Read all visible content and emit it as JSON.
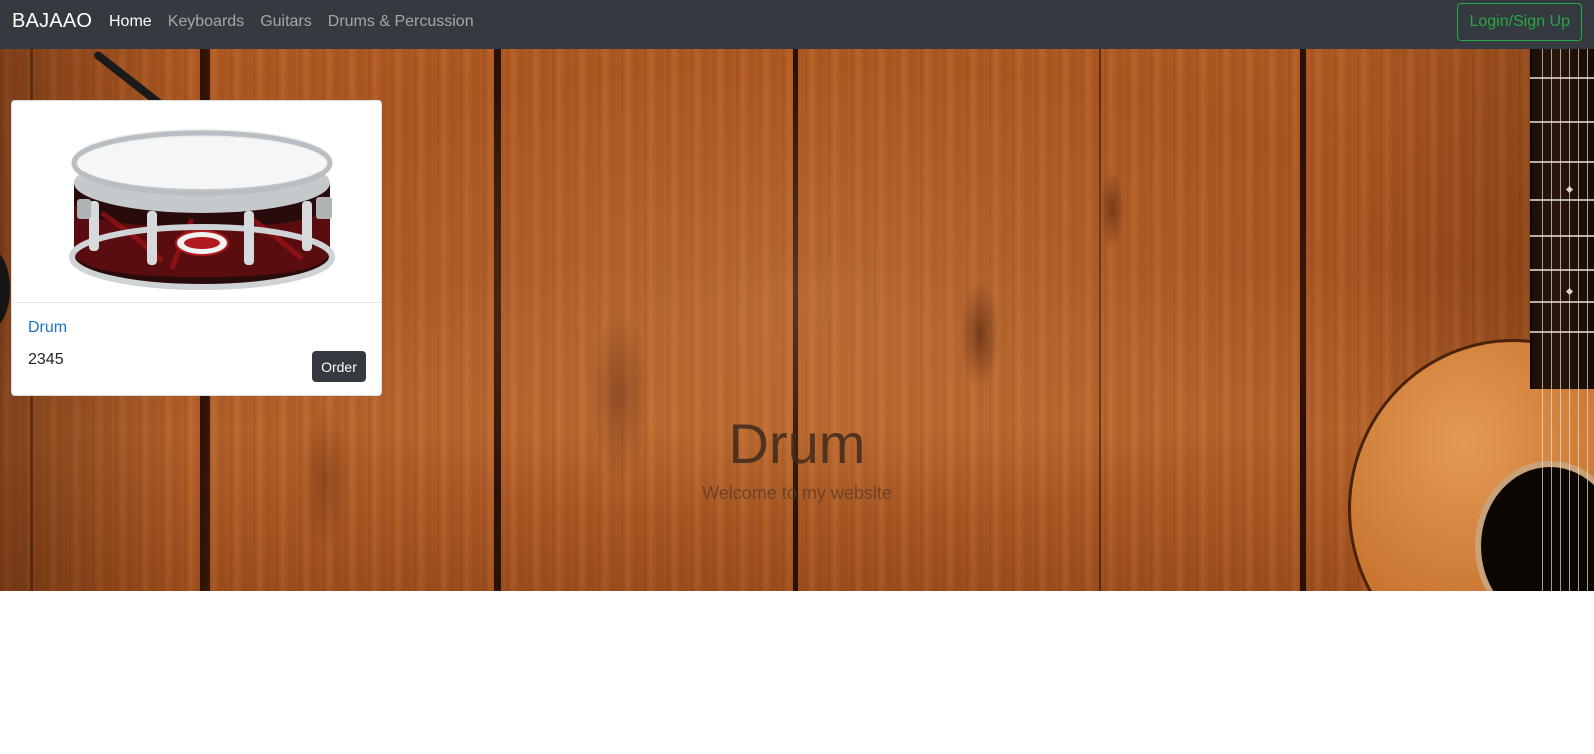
{
  "navbar": {
    "brand": "BAJAAO",
    "links": [
      {
        "label": "Home",
        "active": true
      },
      {
        "label": "Keyboards",
        "active": false
      },
      {
        "label": "Guitars",
        "active": false
      },
      {
        "label": "Drums & Percussion",
        "active": false
      }
    ],
    "login_label": "Login/Sign Up"
  },
  "hero": {
    "title": "Drum",
    "subtitle": "Welcome to my website"
  },
  "product_card": {
    "title": "Drum",
    "price": "2345",
    "order_label": "Order"
  },
  "colors": {
    "navbar_bg": "#343a40",
    "login_accent": "#28a745",
    "link_blue": "#1a73c8",
    "button_dark": "#343a40"
  }
}
